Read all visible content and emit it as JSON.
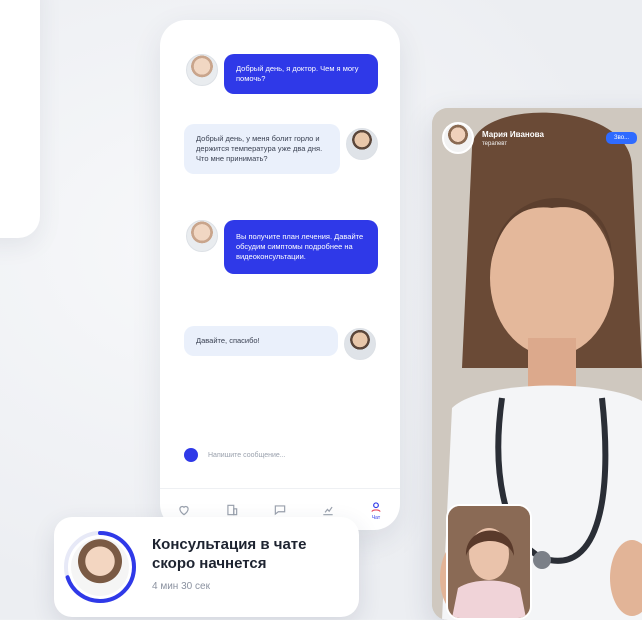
{
  "colors": {
    "accent": "#2f39e8",
    "incoming_bubble": "#eaf0fb",
    "video_badge": "#2f6bff"
  },
  "chat": {
    "messages": [
      {
        "from": "doctor",
        "text": "Добрый день, я доктор. Чем я могу помочь?"
      },
      {
        "from": "patient",
        "text": "Добрый день, у меня болит горло и держится температура уже два дня. Что мне принимать?"
      },
      {
        "from": "doctor",
        "text": "Вы получите план лечения. Давайте обсудим симптомы подробнее на видеоконсультации."
      },
      {
        "from": "patient",
        "text": "Давайте, спасибо!"
      }
    ],
    "input_placeholder": "Напишите сообщение...",
    "tabs": [
      {
        "icon": "heart-icon",
        "label": ""
      },
      {
        "icon": "building-icon",
        "label": ""
      },
      {
        "icon": "chat-icon",
        "label": ""
      },
      {
        "icon": "chart-icon",
        "label": ""
      },
      {
        "icon": "profile-icon",
        "label": "Чат"
      }
    ]
  },
  "video": {
    "doctor_name": "Мария Иванова",
    "doctor_role": "терапевт",
    "badge": "Зво..."
  },
  "notification": {
    "title": "Консультация в чате скоро начнется",
    "time": "4 мин 30 сек",
    "progress_fraction": 0.7
  }
}
